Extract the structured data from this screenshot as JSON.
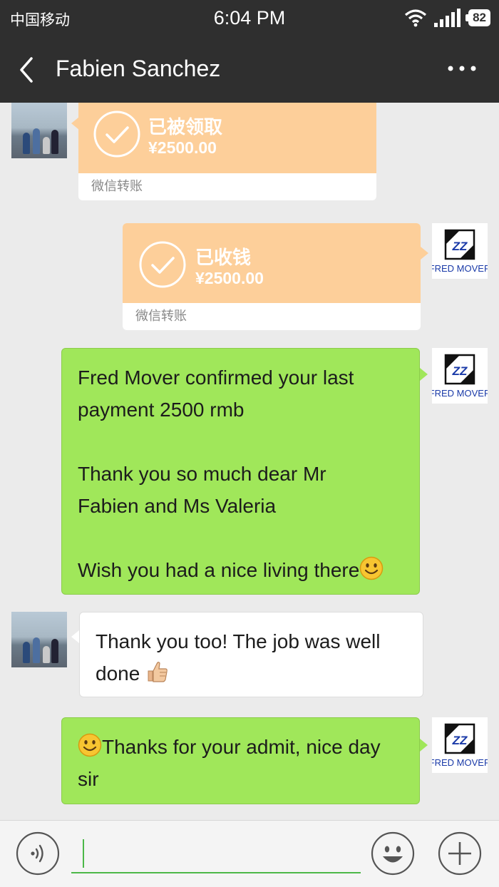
{
  "status_bar": {
    "carrier": "中国移动",
    "time": "6:04 PM",
    "battery": "82"
  },
  "header": {
    "title": "Fabien Sanchez"
  },
  "messages": [
    {
      "type": "transfer",
      "side": "left",
      "status": "已被领取",
      "amount": "¥2500.00",
      "footer": "微信转账"
    },
    {
      "type": "transfer",
      "side": "right",
      "status": "已收钱",
      "amount": "¥2500.00",
      "footer": "微信转账"
    },
    {
      "type": "text",
      "side": "right",
      "text": "Fred Mover confirmed your last\npayment 2500 rmb\n\nThank you so much dear Mr\nFabien and Ms Valeria\n\nWish you had a nice living there",
      "emoji_end": "smile-emoji"
    },
    {
      "type": "text",
      "side": "left",
      "text_a": "Thank you too! The job was well",
      "text_b": "done ",
      "emoji_end": "thumbs-up-emoji"
    },
    {
      "type": "text",
      "side": "right",
      "emoji_start": "smile-emoji",
      "text_a": "Thanks for your admit, nice day",
      "text_b": "sir"
    }
  ],
  "logo": {
    "text": "FRED MOVER",
    "mark": "ZZ"
  },
  "colors": {
    "green_bubble": "#a0e75a",
    "transfer_orange": "#fdcf9a",
    "bar_dark": "#2f2f2f",
    "accent_green": "#4cb848"
  }
}
